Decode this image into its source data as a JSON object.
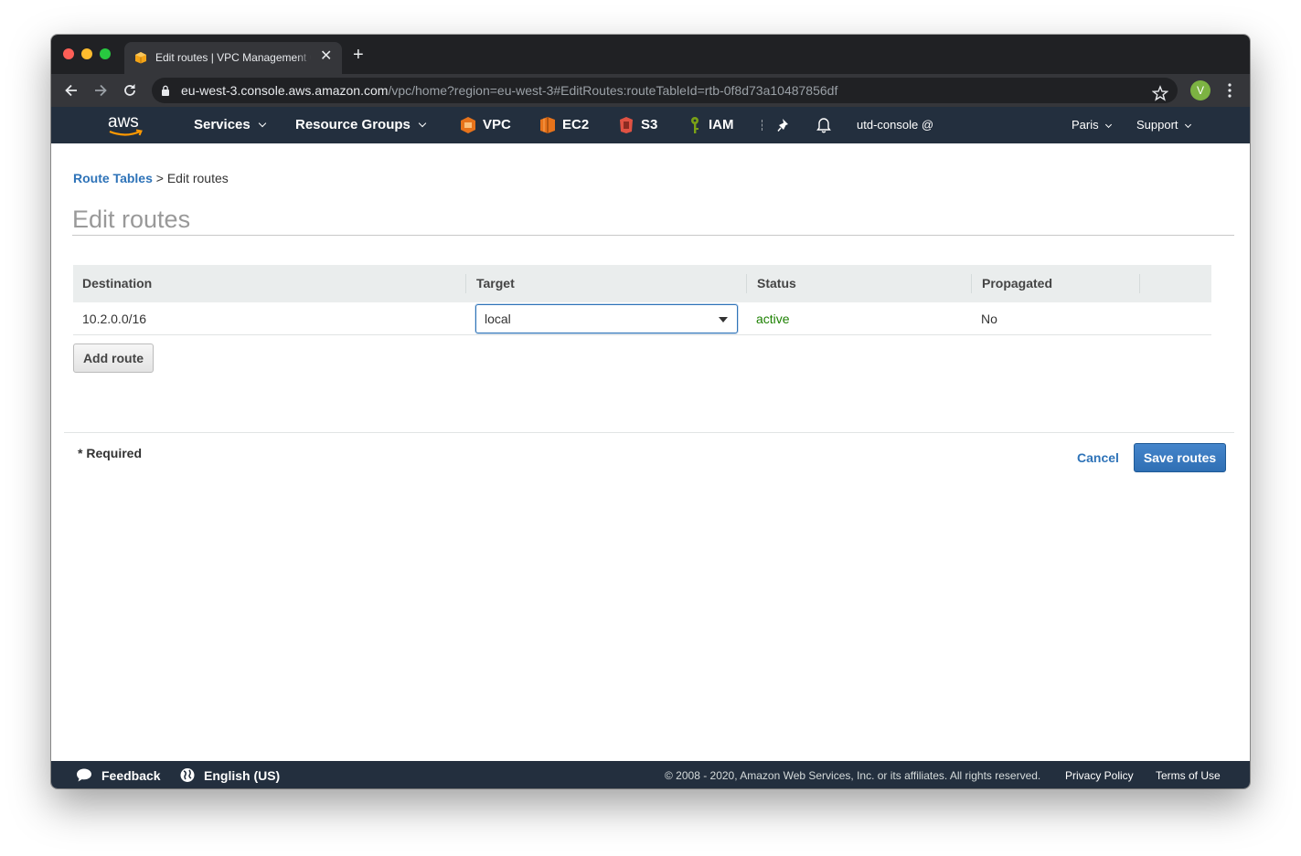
{
  "browser": {
    "tab_title": "Edit routes | VPC Management Console",
    "tab_close": "✕",
    "new_tab": "+",
    "url_host": "eu-west-3.console.aws.amazon.com",
    "url_path": "/vpc/home?region=eu-west-3#EditRoutes:routeTableId=rtb-0f8d73a10487856df",
    "profile_initial": "V"
  },
  "aws_nav": {
    "services": "Services",
    "resource_groups": "Resource Groups",
    "shortcuts": [
      "VPC",
      "EC2",
      "S3",
      "IAM"
    ],
    "account": "utd-console @",
    "region": "Paris",
    "support": "Support"
  },
  "breadcrumb": {
    "parent": "Route Tables",
    "separator": " > ",
    "current": "Edit routes"
  },
  "page_title": "Edit routes",
  "routes_table": {
    "headers": {
      "destination": "Destination",
      "target": "Target",
      "status": "Status",
      "propagated": "Propagated"
    },
    "rows": [
      {
        "destination": "10.2.0.0/16",
        "target": "local",
        "status": "active",
        "propagated": "No"
      }
    ]
  },
  "actions": {
    "add_route": "Add route",
    "required_note": "* Required",
    "cancel": "Cancel",
    "save": "Save routes"
  },
  "footer": {
    "feedback": "Feedback",
    "language": "English (US)",
    "copyright": "© 2008 - 2020, Amazon Web Services, Inc. or its affiliates. All rights reserved.",
    "privacy": "Privacy Policy",
    "terms": "Terms of Use"
  },
  "colors": {
    "aws_nav_bg": "#232f3e",
    "link_blue": "#2e73b8",
    "status_green": "#1d8102",
    "primary_button": "#3a7ac0"
  }
}
